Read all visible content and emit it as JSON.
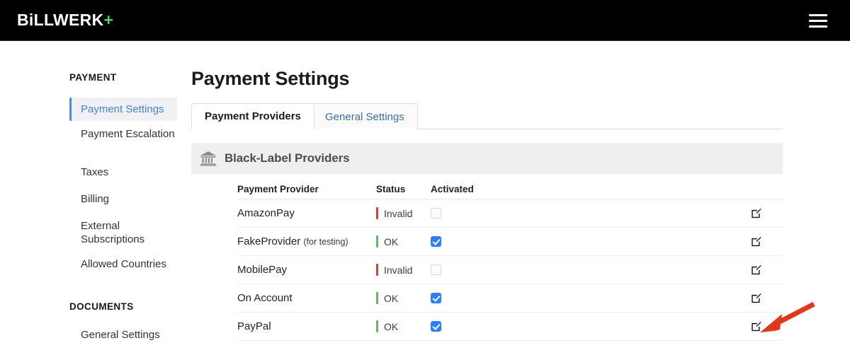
{
  "header": {
    "brand_text": "BiLLWERK",
    "brand_plus": "+",
    "menu_icon": "hamburger-menu-icon"
  },
  "sidebar": {
    "groups": [
      {
        "title": "PAYMENT",
        "items": [
          {
            "label": "Payment Settings",
            "active": true
          },
          {
            "label": "Payment Escalation",
            "active": false
          },
          {
            "label": "Taxes",
            "active": false
          },
          {
            "label": "Billing",
            "active": false
          },
          {
            "label": "External Subscriptions",
            "active": false
          },
          {
            "label": "Allowed Countries",
            "active": false
          }
        ]
      },
      {
        "title": "DOCUMENTS",
        "items": [
          {
            "label": "General Settings",
            "active": false
          }
        ]
      }
    ]
  },
  "main": {
    "page_title": "Payment Settings",
    "tabs": [
      {
        "label": "Payment Providers",
        "active": true
      },
      {
        "label": "General Settings",
        "active": false
      }
    ],
    "section": {
      "icon": "bank-icon",
      "title": "Black-Label Providers"
    },
    "table": {
      "columns": [
        "Payment Provider",
        "Status",
        "Activated"
      ],
      "rows": [
        {
          "provider": "AmazonPay",
          "provider_note": "",
          "status": "Invalid",
          "status_kind": "invalid",
          "activated": false,
          "edit_icon": "edit-pencil-square-icon"
        },
        {
          "provider": "FakeProvider",
          "provider_note": "(for testing)",
          "status": "OK",
          "status_kind": "ok",
          "activated": true,
          "edit_icon": "edit-pencil-square-icon"
        },
        {
          "provider": "MobilePay",
          "provider_note": "",
          "status": "Invalid",
          "status_kind": "invalid",
          "activated": false,
          "edit_icon": "edit-pencil-square-icon"
        },
        {
          "provider": "On Account",
          "provider_note": "",
          "status": "OK",
          "status_kind": "ok",
          "activated": true,
          "edit_icon": "edit-pencil-square-icon"
        },
        {
          "provider": "PayPal",
          "provider_note": "",
          "status": "OK",
          "status_kind": "ok",
          "activated": true,
          "edit_icon": "edit-pencil-square-icon"
        }
      ]
    }
  },
  "annotation": {
    "arrow_color": "#e0381f",
    "points_to": "PayPal row edit icon"
  },
  "colors": {
    "header_bg": "#000000",
    "brand_plus": "#4cd26a",
    "accent_blue": "#4a7fd4",
    "checkbox_on": "#2f7ef5",
    "status_ok": "#55c257",
    "status_invalid": "#e03a2f",
    "section_bg": "#efefef"
  }
}
